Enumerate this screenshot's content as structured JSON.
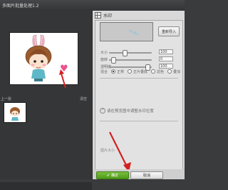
{
  "window": {
    "title": "多图片批量处理1.2"
  },
  "left": {
    "ctrl_left_label": "上一张",
    "ctrl_right_label": "清空",
    "heart_symbol": "♥"
  },
  "watermark": {
    "header_label": "水印",
    "select_label": "重新导入",
    "sliders": [
      {
        "label": "大小",
        "value": "100",
        "level": 0.32
      },
      {
        "label": "旋转",
        "value": "0",
        "level": 0.05
      },
      {
        "label": "透明度",
        "value": "100",
        "level": 0.85
      }
    ],
    "mix_label": "混合",
    "mix_options": [
      "正常",
      "正片叠底",
      "滤色",
      "叠加"
    ],
    "mix_selected": 0,
    "instruction": "请在预览图中调整水印位置",
    "size_label": "图片大小"
  },
  "footer": {
    "ok_label": "确定",
    "cancel_label": "取消"
  },
  "colors": {
    "accent_green": "#5aa51f",
    "arrow_red": "#d42020"
  }
}
